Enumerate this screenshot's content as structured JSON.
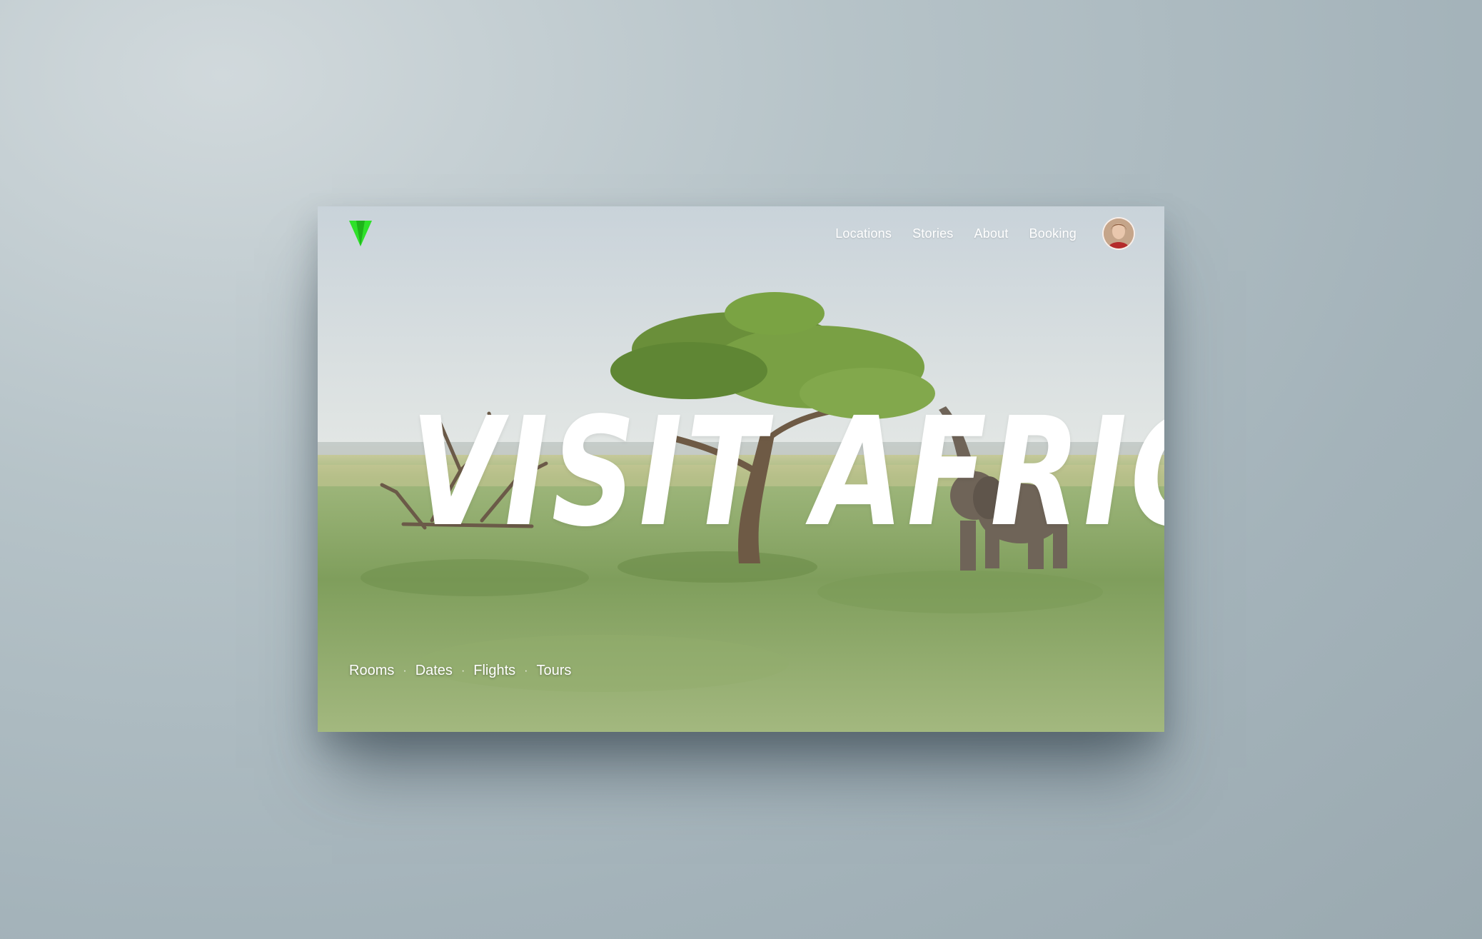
{
  "colors": {
    "accent": "#2fe12a",
    "text": "#ffffff"
  },
  "header": {
    "logo_icon": "green-arrow-logo-icon",
    "nav": [
      "Locations",
      "Stories",
      "About",
      "Booking"
    ],
    "avatar_icon": "user-avatar-icon"
  },
  "hero": {
    "title": "VISIT AFRICA"
  },
  "footer_nav": {
    "items": [
      "Rooms",
      "Dates",
      "Flights",
      "Tours"
    ]
  }
}
